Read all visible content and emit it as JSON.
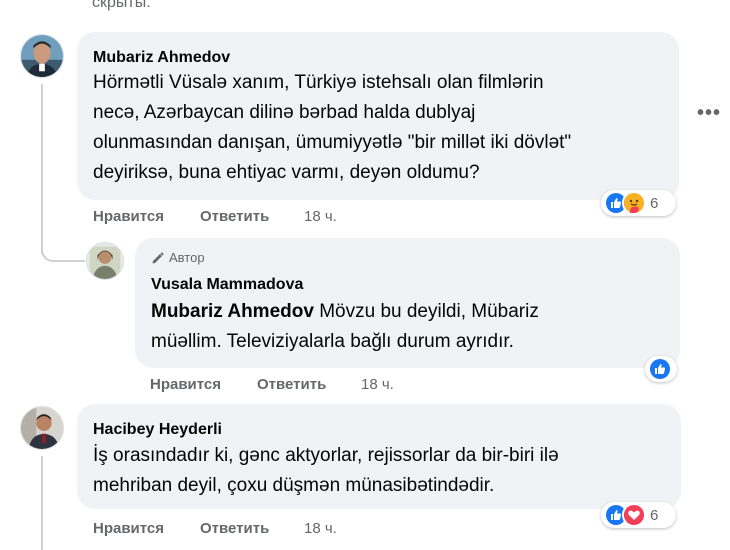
{
  "top_text": "скрыты.",
  "more_icon": "more-horizontal-icon",
  "comments": [
    {
      "author": "Mubariz Ahmedov",
      "lines": [
        "Hörmətli Vüsalə xanım, Türkiyə istehsalı olan filmlərin",
        "necə, Azərbaycan dilinə bərbad halda dublyaj",
        "olunmasından danışan, ümumiyyətlə \"bir millət iki dövlət\"",
        "deyiriksə, buna ehtiyac varmı, deyən oldumu?"
      ],
      "like_label": "Нравится",
      "reply_label": "Ответить",
      "time": "18 ч.",
      "reactions": [
        "like",
        "care"
      ],
      "reaction_count": "6"
    },
    {
      "author_badge": "Автор",
      "author": "Vusala Mammadova",
      "mention": "Mubariz Ahmedov",
      "first_line_rest": " Mövzu bu deyildi, Mübariz",
      "line2": "müəllim. Televiziyalarla bağlı durum ayrıdır.",
      "like_label": "Нравится",
      "reply_label": "Ответить",
      "time": "18 ч.",
      "reactions": [
        "like"
      ]
    },
    {
      "author": "Hacibey Heyderli",
      "lines": [
        "İş orasındadır ki, gənc aktyorlar, rejissorlar da bir-biri ilə",
        "mehriban deyil, çoxu düşmən münasibətindədir."
      ],
      "like_label": "Нравится",
      "reply_label": "Ответить",
      "time": "18 ч.",
      "reactions": [
        "like",
        "love"
      ],
      "reaction_count": "6"
    }
  ],
  "colors": {
    "like_blue": "#1877f2",
    "love_red": "#f33e58",
    "care_yellow": "#f7b125",
    "bubble_bg": "#f0f2f5",
    "secondary_text": "#65676b"
  }
}
